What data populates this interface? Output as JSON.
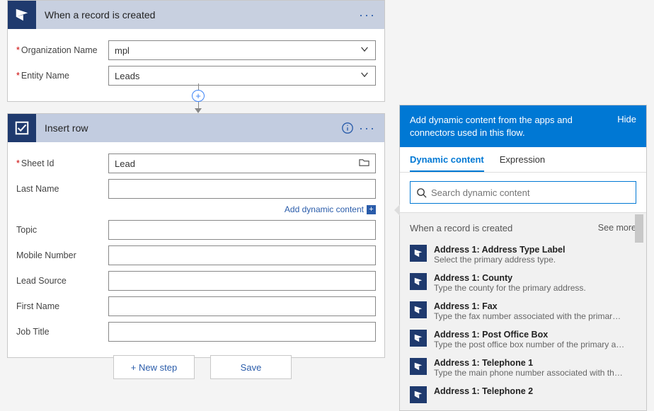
{
  "trigger": {
    "title": "When a record is created",
    "fields": {
      "org_label": "Organization Name",
      "org_value": "mpl",
      "entity_label": "Entity Name",
      "entity_value": "Leads"
    }
  },
  "action": {
    "title": "Insert row",
    "add_dynamic_link": "Add dynamic content",
    "fields": {
      "sheet_label": "Sheet Id",
      "sheet_value": "Lead",
      "lastname_label": "Last Name",
      "lastname_value": "",
      "topic_label": "Topic",
      "topic_value": "",
      "mobile_label": "Mobile Number",
      "mobile_value": "",
      "leadsource_label": "Lead Source",
      "leadsource_value": "",
      "firstname_label": "First Name",
      "firstname_value": "",
      "jobtitle_label": "Job Title",
      "jobtitle_value": ""
    }
  },
  "bottom": {
    "new_step": "+ New step",
    "save": "Save"
  },
  "panel": {
    "header": "Add dynamic content from the apps and connectors used in this flow.",
    "hide": "Hide",
    "tab_dynamic": "Dynamic content",
    "tab_expression": "Expression",
    "search_placeholder": "Search dynamic content",
    "section_title": "When a record is created",
    "see_more": "See more",
    "items": [
      {
        "title": "Address 1: Address Type Label",
        "desc": "Select the primary address type."
      },
      {
        "title": "Address 1: County",
        "desc": "Type the county for the primary address."
      },
      {
        "title": "Address 1: Fax",
        "desc": "Type the fax number associated with the primary address."
      },
      {
        "title": "Address 1: Post Office Box",
        "desc": "Type the post office box number of the primary address."
      },
      {
        "title": "Address 1: Telephone 1",
        "desc": "Type the main phone number associated with the primar..."
      },
      {
        "title": "Address 1: Telephone 2",
        "desc": ""
      }
    ]
  }
}
